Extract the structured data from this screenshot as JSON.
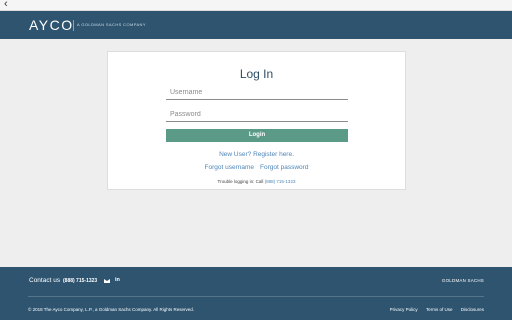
{
  "topbar": {
    "back_icon": "chevron-left-icon",
    "back_glyph": "‹"
  },
  "header": {
    "logo": "AYCO",
    "logo_sub": "A GOLDMAN SACHS COMPANY"
  },
  "login": {
    "title": "Log In",
    "username_placeholder": "Username",
    "password_placeholder": "Password",
    "login_button": "Login",
    "new_user_link": "New User? Register here.",
    "forgot_username": "Forgot username",
    "forgot_password": "Forgot password",
    "trouble_text": "Trouble logging in: Call",
    "trouble_phone": "(888) 715-1323"
  },
  "footer": {
    "contact_label": "Contact us",
    "phone": "(888) 715-1323",
    "linkedin_glyph": "in",
    "brand": "GOLDMAN SACHS",
    "copyright": "© 2018 The Ayco Company, L.P., a Goldman Sachs Company. All Rights Reserved.",
    "links": [
      "Privacy Policy",
      "Terms of Use",
      "Disclosures"
    ]
  },
  "colors": {
    "header_bg": "#2e5470",
    "button_bg": "#5b9a86",
    "link": "#4d86b8"
  }
}
